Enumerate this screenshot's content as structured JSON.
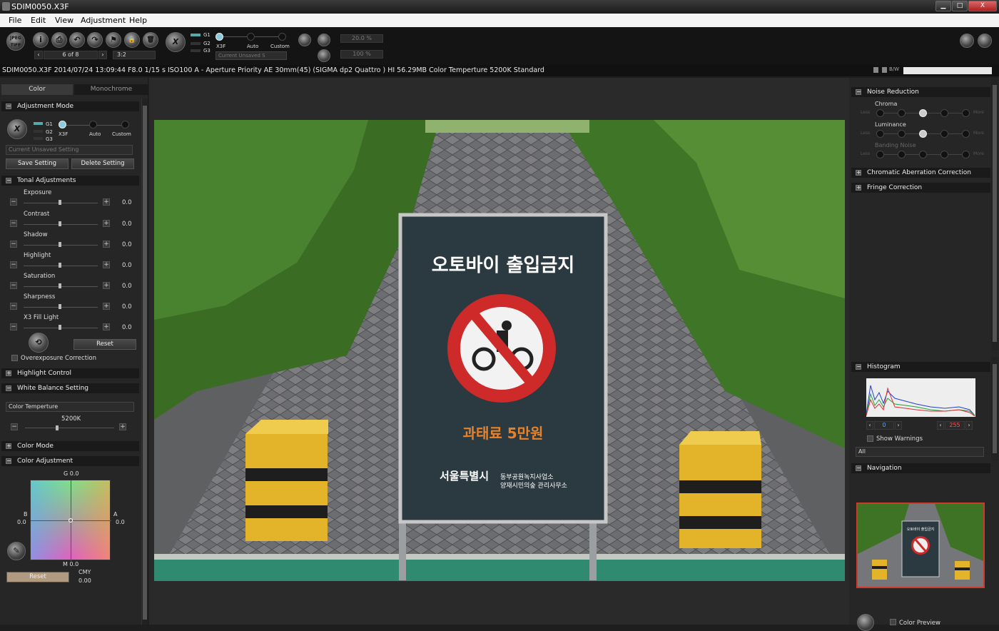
{
  "window": {
    "title": "SDIM0050.X3F",
    "min": "▁",
    "max": "□",
    "close": "X"
  },
  "menu": [
    "File",
    "Edit",
    "View",
    "Adjustment",
    "Help"
  ],
  "toolbar": {
    "nav_text": "6 of 8",
    "nav_prev": "‹",
    "nav_next": "›",
    "ratio": "3:2",
    "g1": "G1",
    "g2": "G2",
    "g3": "G3",
    "x3f": "X3F",
    "auto": "Auto",
    "custom": "Custom",
    "zoom1": "20.0 %",
    "zoom2": "100 %",
    "preset": "Current Unsaved S",
    "info_btn": "i",
    "print_btn": "⎙",
    "rot_left": "↶",
    "rot_right": "↷",
    "flag_btn": "⚑",
    "lock_btn": "🔒",
    "trash_btn": "🗑",
    "jpeg_label": "JPEG TIFF"
  },
  "info_bar": {
    "text": "SDIM0050.X3F 2014/07/24 13:09:44 F8.0 1/15 s ISO100 A - Aperture Priority AE 30mm(45) (SIGMA dp2 Quattro ) HI 56.29MB Color Temperture 5200K Standard",
    "bw": "B/W"
  },
  "left": {
    "tabs": [
      "Color",
      "Monochrome"
    ],
    "adjustment_mode": "Adjustment Mode",
    "modes": {
      "g1": "G1",
      "g2": "G2",
      "g3": "G3",
      "x3f": "X3F",
      "auto": "Auto",
      "custom": "Custom"
    },
    "setting_dropdown": "Current Unsaved Setting",
    "save_setting": "Save Setting",
    "delete_setting": "Delete Setting",
    "tonal": "Tonal Adjustments",
    "sliders": [
      {
        "label": "Exposure",
        "value": "0.0"
      },
      {
        "label": "Contrast",
        "value": "0.0"
      },
      {
        "label": "Shadow",
        "value": "0.0"
      },
      {
        "label": "Highlight",
        "value": "0.0"
      },
      {
        "label": "Saturation",
        "value": "0.0"
      },
      {
        "label": "Sharpness",
        "value": "0.0"
      },
      {
        "label": "X3 Fill Light",
        "value": "0.0"
      }
    ],
    "reset": "Reset",
    "overexposure": "Overexposure Correction",
    "highlight_control": "Highlight Control",
    "white_balance": "White Balance Setting",
    "wb_dropdown": "Color Temperture",
    "wb_value": "5200K",
    "color_mode": "Color Mode",
    "color_adjustment": "Color Adjustment",
    "grid": {
      "top": "G 0.0",
      "left_label": "B",
      "left_val": "0.0",
      "right_label": "A",
      "right_val": "0.0",
      "bottom": "M 0.0",
      "cmy_label": "CMY",
      "cmy_val": "0.00"
    },
    "grid_reset": "Reset",
    "minus": "−",
    "plus": "+",
    "expand": "+",
    "collapse": "−"
  },
  "photo": {
    "sign_title": "오토바이 출입금지",
    "sign_fine": "과태료 5만원",
    "sign_org": "서울특별시",
    "sign_line1": "동부공원녹지사업소",
    "sign_line2": "양재시민의숲 관리사무소"
  },
  "right": {
    "noise_reduction": "Noise Reduction",
    "nr": [
      {
        "label": "Chroma",
        "less": "Less",
        "more": "More",
        "level": 2
      },
      {
        "label": "Luminance",
        "less": "Less",
        "more": "More",
        "level": 2
      },
      {
        "label": "Banding Noise",
        "less": "Less",
        "more": "More",
        "level": -1
      }
    ],
    "chromatic": "Chromatic Aberration Correction",
    "fringe": "Fringe Correction",
    "histogram": "Histogram",
    "hist_min": "0",
    "hist_max": "255",
    "show_warnings": "Show Warnings",
    "channel": "All",
    "navigation": "Navigation",
    "color_preview": "Color Preview",
    "nav_sign_title": "오토바이 출입금지"
  }
}
